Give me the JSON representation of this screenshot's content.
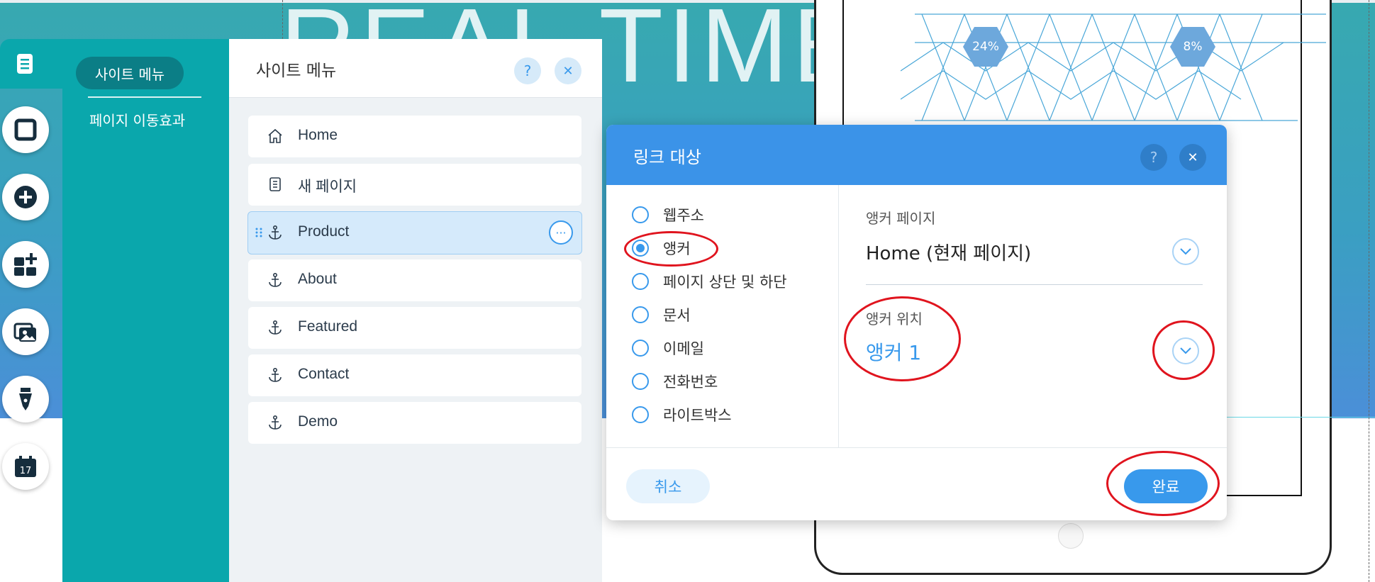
{
  "background": {
    "headline": "REAL TIME",
    "hex_badges": [
      "24%",
      "8%"
    ]
  },
  "site_menu_tabs": {
    "active": "사이트 메뉴",
    "other": "페이지 이동효과"
  },
  "menu_panel": {
    "title": "사이트 메뉴",
    "help": "?",
    "close": "✕",
    "pages": [
      {
        "label": "Home",
        "icon": "home-icon"
      },
      {
        "label": "새 페이지",
        "icon": "page-icon"
      },
      {
        "label": "Product",
        "icon": "anchor-icon",
        "selected": true
      },
      {
        "label": "About",
        "icon": "anchor-icon"
      },
      {
        "label": "Featured",
        "icon": "anchor-icon"
      },
      {
        "label": "Contact",
        "icon": "anchor-icon"
      },
      {
        "label": "Demo",
        "icon": "anchor-icon"
      }
    ],
    "more": "···"
  },
  "dialog": {
    "title": "링크 대상",
    "help": "?",
    "close": "✕",
    "options": [
      "웹주소",
      "앵커",
      "페이지 상단 및 하단",
      "문서",
      "이메일",
      "전화번호",
      "라이트박스"
    ],
    "selected_option": "앵커",
    "anchor_page_label": "앵커 페이지",
    "anchor_page_value": "Home (현재 페이지)",
    "anchor_position_label": "앵커 위치",
    "anchor_position_value": "앵커 1",
    "cancel": "취소",
    "done": "완료"
  },
  "colors": {
    "accent": "#3899ec",
    "teal_panel": "#0aa7ac",
    "annotation": "#e0141e"
  }
}
